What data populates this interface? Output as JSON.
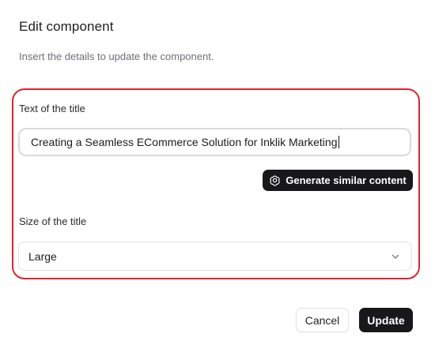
{
  "dialog": {
    "title": "Edit component",
    "description": "Insert the details to update the component."
  },
  "form": {
    "title_text": {
      "label": "Text of the title",
      "value": "Creating a Seamless ECommerce Solution for Inklik Marketing"
    },
    "generate_button": {
      "label": "Generate similar content",
      "icon": "openai-icon"
    },
    "title_size": {
      "label": "Size of the title",
      "selected": "Large"
    }
  },
  "actions": {
    "cancel_label": "Cancel",
    "update_label": "Update"
  },
  "colors": {
    "highlight_border": "#e3222e",
    "primary_button": "#18181b"
  }
}
